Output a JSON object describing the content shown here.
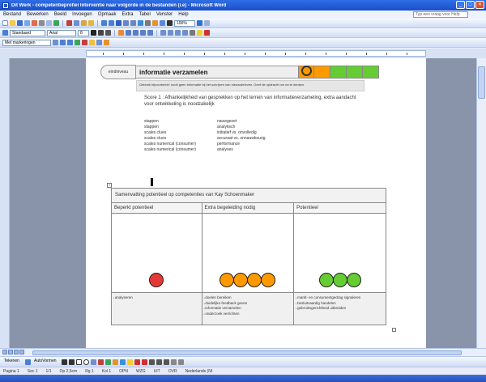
{
  "window": {
    "title": "Dit Werk - competentieprofiel Interventie naar volgorde in de bestanden (i.e) - Microsoft Word",
    "buttons": [
      "_",
      "□",
      "✕"
    ]
  },
  "menu": {
    "items": [
      "Bestand",
      "Bewerken",
      "Beeld",
      "Invoegen",
      "Opmaak",
      "Extra",
      "Tabel",
      "Venster",
      "Help"
    ],
    "help_placeholder": "Typ een vraag voor Help"
  },
  "toolbars": {
    "style_value": "Standaard",
    "font_value": "Arial",
    "size_value": "8",
    "zoom_value": "100%",
    "view_value": "Met markeringen"
  },
  "header": {
    "tab_label": "eindniveau",
    "title": "informatie verzamelen",
    "intro": "Gebruik bijvoorbeeld: nooit geen informatie bij het schrijven van nieuwsbrieven. Geef de opdracht om na te denken.",
    "score_line": "Score 1 : Afhankelijkheid van gesprekken op het terrein van informatieverzameling, extra aandacht voor ontwikkeling is noodzakelijk",
    "colors": {
      "cell_orange": "#ff9900",
      "cell_green": "#66cc33"
    }
  },
  "key_values": [
    {
      "k": "stappen",
      "v": "nauwgezet"
    },
    {
      "k": "stappen",
      "v": "analytisch"
    },
    {
      "k": "scales clues",
      "v": "initiatief vs. onvolledig"
    },
    {
      "k": "scales clues",
      "v": "accuraat vs. onnauwkeurig"
    },
    {
      "k": "scales numerical (consumer)",
      "v": "performance"
    },
    {
      "k": "scales numerical (consumer)",
      "v": "analyses"
    }
  ],
  "table": {
    "caption": "Samenvatting potentieel op competenties van Kay Schoenmaker",
    "headers": [
      "Beperkt potentieel",
      "Extra begeleiding nodig",
      "Potentieel"
    ],
    "dots": [
      {
        "color": "#e53935",
        "count": 1
      },
      {
        "color": "#ff9900",
        "count": 4
      },
      {
        "color": "#66cc33",
        "count": 3
      }
    ],
    "lists": [
      [
        "analyseren"
      ],
      [
        "doelen bereiken",
        "duidelijke feedback geven",
        "informatie verzamelen",
        "onderzoek verrichten"
      ],
      [
        "markt- en consumentgedrag signaleren",
        "besluitvaardig handelen",
        "gebruiksgerichtheid uitbreiden"
      ]
    ]
  },
  "drawbar": {
    "label": "Tekenen",
    "autoshapes": "AutoVormen"
  },
  "status": {
    "items": [
      "Pagina 1",
      "Sec 1",
      "1/1",
      "Op 2,5cm",
      "Rg 1",
      "Kol 1",
      "OPN",
      "WZG",
      "UIT",
      "OVR",
      "Nederlands (NI"
    ]
  }
}
